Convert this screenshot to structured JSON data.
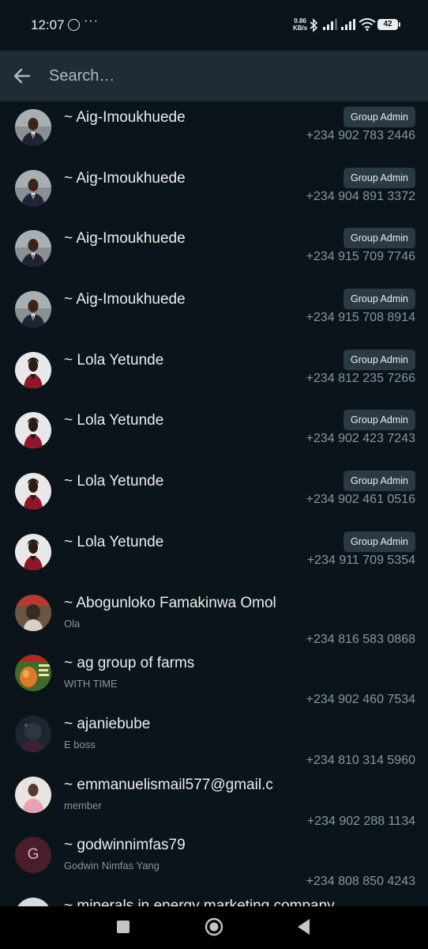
{
  "status_bar": {
    "time": "12:07",
    "dots": "···",
    "net_speed_value": "0.86",
    "net_speed_unit": "KB/s",
    "battery": "42"
  },
  "search": {
    "placeholder": "Search…"
  },
  "members": [
    {
      "name": "~ Aig-Imoukhuede",
      "badge": "Group Admin",
      "phone": "+234 902 783 2446",
      "avatar": "man-suit"
    },
    {
      "name": "~ Aig-Imoukhuede",
      "badge": "Group Admin",
      "phone": "+234 904 891 3372",
      "avatar": "man-suit"
    },
    {
      "name": "~ Aig-Imoukhuede",
      "badge": "Group Admin",
      "phone": "+234 915 709 7746",
      "avatar": "man-suit"
    },
    {
      "name": "~ Aig-Imoukhuede",
      "badge": "Group Admin",
      "phone": "+234 915 708 8914",
      "avatar": "man-suit"
    },
    {
      "name": "~ Lola Yetunde",
      "badge": "Group Admin",
      "phone": "+234 812 235 7266",
      "avatar": "woman-red"
    },
    {
      "name": "~ Lola Yetunde",
      "badge": "Group Admin",
      "phone": "+234 902 423 7243",
      "avatar": "woman-red"
    },
    {
      "name": "~ Lola Yetunde",
      "badge": "Group Admin",
      "phone": "+234 902 461 0516",
      "avatar": "woman-red"
    },
    {
      "name": "~ Lola Yetunde",
      "badge": "Group Admin",
      "phone": "+234 911 709 5354",
      "avatar": "woman-red"
    },
    {
      "name": "~ Abogunloko Famakinwa Omol",
      "about": "Ola",
      "phone": "+234 816 583 0868",
      "avatar": "child-photo"
    },
    {
      "name": "~ ag group of farms",
      "about": "WITH TIME",
      "phone": "+234 902 460 7534",
      "avatar": "eggs-poster"
    },
    {
      "name": "~ ajaniebube",
      "about": "E boss",
      "phone": "+234 810 314 5960",
      "avatar": "dark-photo"
    },
    {
      "name": "~ emmanuelismail577@gmail.c",
      "about": "member",
      "phone": "+234 902 288 1134",
      "avatar": "man-pink"
    },
    {
      "name": "~ godwinnimfas79",
      "about": "Godwin Nimfas Yang",
      "phone": "+234 808 850 4243",
      "avatar": "letter",
      "avatar_letter": "G"
    },
    {
      "name": "~ minerals in energy marketing company",
      "avatar": "partial-photo"
    }
  ],
  "colors": {
    "background": "#0b141a",
    "header": "#1f2c33",
    "badge": "#2a3942",
    "primary_text": "#e9edef",
    "secondary_text": "#8696a0"
  }
}
